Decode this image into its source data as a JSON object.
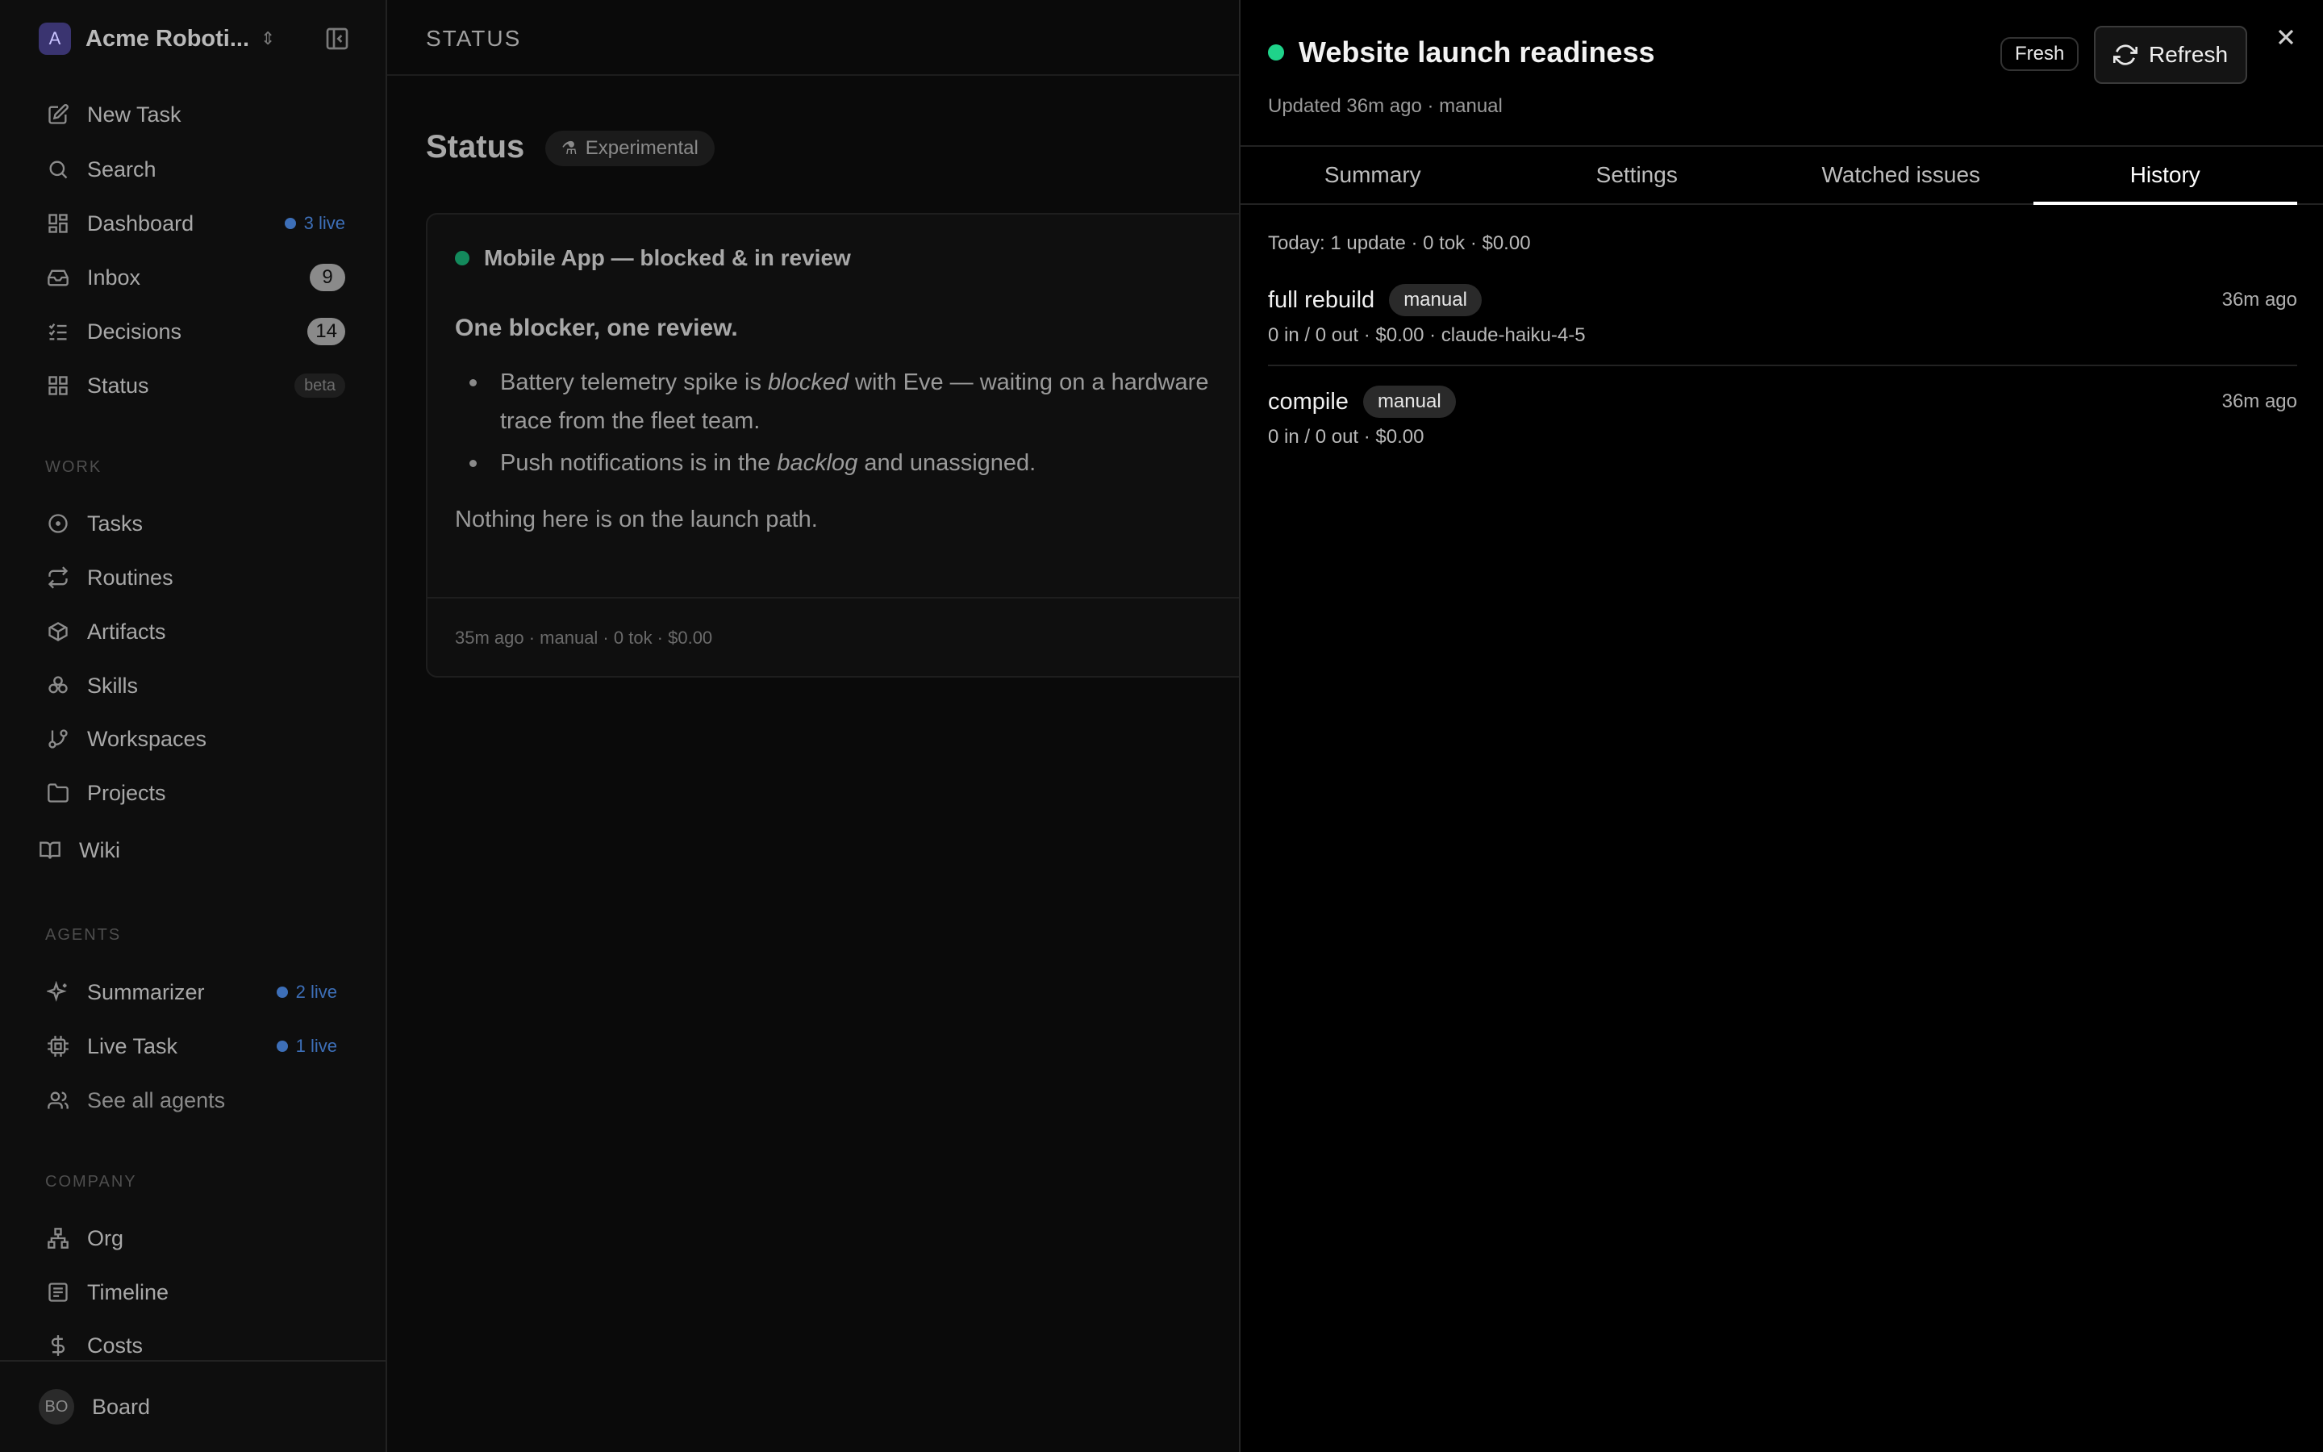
{
  "workspace": {
    "initial": "A",
    "name": "Acme Roboti..."
  },
  "nav": {
    "new_task": "New Task",
    "search": "Search",
    "dashboard": "Dashboard",
    "dashboard_live": "3 live",
    "inbox": "Inbox",
    "inbox_count": "9",
    "decisions": "Decisions",
    "decisions_count": "14",
    "status": "Status",
    "status_badge": "beta"
  },
  "sections": {
    "work": "WORK",
    "agents": "AGENTS",
    "company": "COMPANY"
  },
  "work": {
    "tasks": "Tasks",
    "routines": "Routines",
    "artifacts": "Artifacts",
    "skills": "Skills",
    "workspaces": "Workspaces",
    "projects": "Projects",
    "wiki": "Wiki"
  },
  "agents": {
    "summarizer": "Summarizer",
    "summarizer_live": "2 live",
    "live_task": "Live Task",
    "live_task_live": "1 live",
    "see_all": "See all agents"
  },
  "company": {
    "org": "Org",
    "timeline": "Timeline",
    "costs": "Costs"
  },
  "footer": {
    "avatar": "BO",
    "label": "Board"
  },
  "main": {
    "topbar_title": "STATUS",
    "page_title": "Status",
    "experimental": "Experimental",
    "card": {
      "title": "Mobile App — blocked & in review",
      "lead": "One blocker, one review.",
      "item1_a": "Battery telemetry spike is ",
      "item1_em": "blocked",
      "item1_b": " with Eve — waiting on a hardware trace from the fleet team.",
      "item2_a": "Push notifications is in the ",
      "item2_em": "backlog",
      "item2_b": " and unassigned.",
      "closing": "Nothing here is on the launch path.",
      "meta": "35m ago · manual · 0 tok · $0.00"
    }
  },
  "panel": {
    "title": "Website launch readiness",
    "subtitle": "Updated 36m ago · manual",
    "fresh": "Fresh",
    "refresh": "Refresh",
    "status_color": "#1fd38a",
    "tabs": [
      "Summary",
      "Settings",
      "Watched issues",
      "History"
    ],
    "active_tab": "History",
    "summary_line": "Today: 1 update · 0 tok · $0.00",
    "history": [
      {
        "name": "full rebuild",
        "badge": "manual",
        "time": "36m ago",
        "meta": "0 in / 0 out · $0.00 · claude-haiku-4-5"
      },
      {
        "name": "compile",
        "badge": "manual",
        "time": "36m ago",
        "meta": "0 in / 0 out · $0.00"
      }
    ]
  }
}
